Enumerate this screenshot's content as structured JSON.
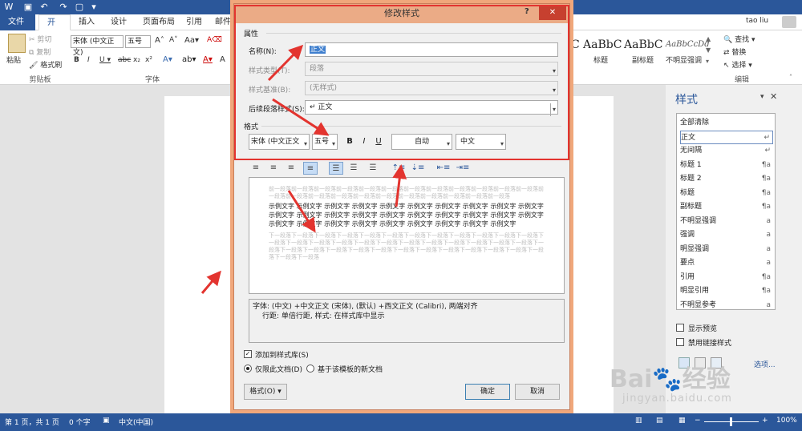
{
  "word": {
    "user": "tao liu",
    "tabs": [
      "文件",
      "开始",
      "插入",
      "设计",
      "页面布局",
      "引用",
      "邮件"
    ],
    "clipboard": {
      "paste": "粘贴",
      "cut": "剪切",
      "copy": "复制",
      "painter": "格式刷",
      "group": "剪贴板"
    },
    "font": {
      "name": "宋体 (中文正文)",
      "size": "五号",
      "group": "字体"
    },
    "styles_gallery": [
      {
        "preview": "AaBbC",
        "label": "标题"
      },
      {
        "preview": "AaBbC",
        "label": "副标题"
      },
      {
        "preview": "AaBbCcDd",
        "label": "不明显强调"
      }
    ],
    "editing": {
      "find": "查找",
      "replace": "替换",
      "select": "选择",
      "group": "编辑"
    },
    "partial_c": "C"
  },
  "styles_pane": {
    "title": "样式",
    "items": [
      {
        "label": "全部清除",
        "mark": ""
      },
      {
        "label": "正文",
        "mark": "↵"
      },
      {
        "label": "无间隔",
        "mark": "↵"
      },
      {
        "label": "标题 1",
        "mark": "¶a"
      },
      {
        "label": "标题 2",
        "mark": "¶a"
      },
      {
        "label": "标题",
        "mark": "¶a"
      },
      {
        "label": "副标题",
        "mark": "¶a"
      },
      {
        "label": "不明显强调",
        "mark": "a"
      },
      {
        "label": "强调",
        "mark": "a"
      },
      {
        "label": "明显强调",
        "mark": "a"
      },
      {
        "label": "要点",
        "mark": "a"
      },
      {
        "label": "引用",
        "mark": "¶a"
      },
      {
        "label": "明显引用",
        "mark": "¶a"
      },
      {
        "label": "不明显参考",
        "mark": "a"
      }
    ],
    "show_preview": "显示预览",
    "disable_linked": "禁用链接样式",
    "options": "选项..."
  },
  "status": {
    "page": "第 1 页，共 1 页",
    "words": "0 个字",
    "lang": "中文(中国)",
    "zoom": "100%"
  },
  "dialog": {
    "title": "修改样式",
    "help": "?",
    "section_props": "属性",
    "name_label": "名称(N):",
    "name_value": "正文",
    "type_label": "样式类型(T):",
    "type_value": "段落",
    "based_label": "样式基准(B):",
    "based_value": "(无样式)",
    "next_label": "后续段落样式(S):",
    "next_value": "↵ 正文",
    "section_format": "格式",
    "font_value": "宋体 (中文正文",
    "size_value": "五号",
    "bold": "B",
    "italic": "I",
    "underline": "U",
    "color_value": "自动",
    "script_value": "中文",
    "preview_prev": "前一段落前一段落前一段落前一段落前一段落前一段落前一段落前一段落前一段落前一段落前一段落前一段落前一段落前一段落前一段落前一段落前一段落前一段落前一段落前一段落前一段落前一段落前一段落",
    "preview_sample": "示例文字 示例文字 示例文字 示例文字 示例文字 示例文字 示例文字 示例文字 示例文字 示例文字 示例文字 示例文字 示例文字 示例文字 示例文字 示例文字 示例文字 示例文字 示例文字 示例文字 示例文字 示例文字 示例文字 示例文字 示例文字 示例文字 示例文字 示例文字 示例文字",
    "preview_next": "下一段落下一段落下一段落下一段落下一段落下一段落下一段落下一段落下一段落下一段落下一段落下一段落下一段落下一段落下一段落下一段落下一段落下一段落下一段落下一段落下一段落下一段落下一段落下一段落下一段落下一段落下一段落下一段落下一段落下一段落下一段落下一段落下一段落下一段落下一段落下一段落下一段落下一段落下一段落",
    "desc_line1": "字体: (中文) +中文正文 (宋体), (默认) +西文正文 (Calibri), 两端对齐",
    "desc_line2": "行距: 单倍行距, 样式: 在样式库中显示",
    "add_to_gallery": "添加到样式库(S)",
    "only_doc": "仅限此文档(D)",
    "new_docs": "基于该模板的新文档",
    "format_btn": "格式(O) ▾",
    "ok": "确定",
    "cancel": "取消"
  },
  "watermark": {
    "brand": "Bai",
    "brand2": "经验",
    "url": "jingyan.baidu.com"
  },
  "colors": {
    "word_blue": "#2b579a",
    "annotation_red": "#e3342f",
    "dialog_frame": "#f0a77b"
  }
}
